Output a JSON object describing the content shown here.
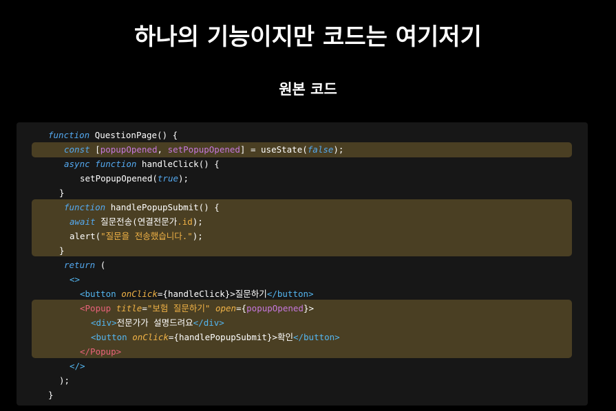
{
  "title": "하나의 기능이지만 코드는 여기저기",
  "subtitle": "원본 코드",
  "code": {
    "l1_kw": "function",
    "l1_rest": "QuestionPage() {",
    "l2_kw": "const",
    "l2_a": "[",
    "l2_v1": "popupOpened",
    "l2_b": ",",
    "l2_v2": "setPopupOpened",
    "l2_c": "] = useState(",
    "l2_val": "false",
    "l2_d": ");",
    "l3_kw1": "async",
    "l3_kw2": "function",
    "l3_rest": "handleClick() {",
    "l4_a": "setPopupOpened(",
    "l4_val": "true",
    "l4_b": ");",
    "l5": "}",
    "l6_kw": "function",
    "l6_rest": "handlePopupSubmit() {",
    "l7_kw": "await",
    "l7_a": "질문전송(연결전문가",
    "l7_b": ".id",
    "l7_c": ");",
    "l8_a": "alert(",
    "l8_str": "\"질문을 전송했습니다.\"",
    "l8_b": ");",
    "l9": "}",
    "l10_kw": "return",
    "l10_rest": "(",
    "l11": "<>",
    "l12_tag": "<button",
    "l12_attr": "onClick",
    "l12_a": "={handleClick}>",
    "l12_text": "질문하기",
    "l12_close": "</button>",
    "l13_tag": "<Popup",
    "l13_attr1": "title",
    "l13_eq1": "=",
    "l13_str": "\"보험 질문하기\"",
    "l13_attr2": "open",
    "l13_eq2": "={",
    "l13_val": "popupOpened",
    "l13_end": "}>",
    "l14_tag": "<div>",
    "l14_text": "전문가가 설명드려요",
    "l14_close": "</div>",
    "l15_tag": "<button",
    "l15_attr": "onClick",
    "l15_a": "={handlePopupSubmit}>",
    "l15_text": "확인",
    "l15_close": "</button>",
    "l16": "</Popup>",
    "l17": "</>",
    "l18": ");",
    "l19": "}"
  },
  "colors": {
    "background": "#000000",
    "panel": "#171717",
    "highlight": "#4a3f23",
    "keyword": "#54a9f0",
    "variable": "#c678dd",
    "tag": "#e8627a",
    "attribute": "#f0b246"
  }
}
